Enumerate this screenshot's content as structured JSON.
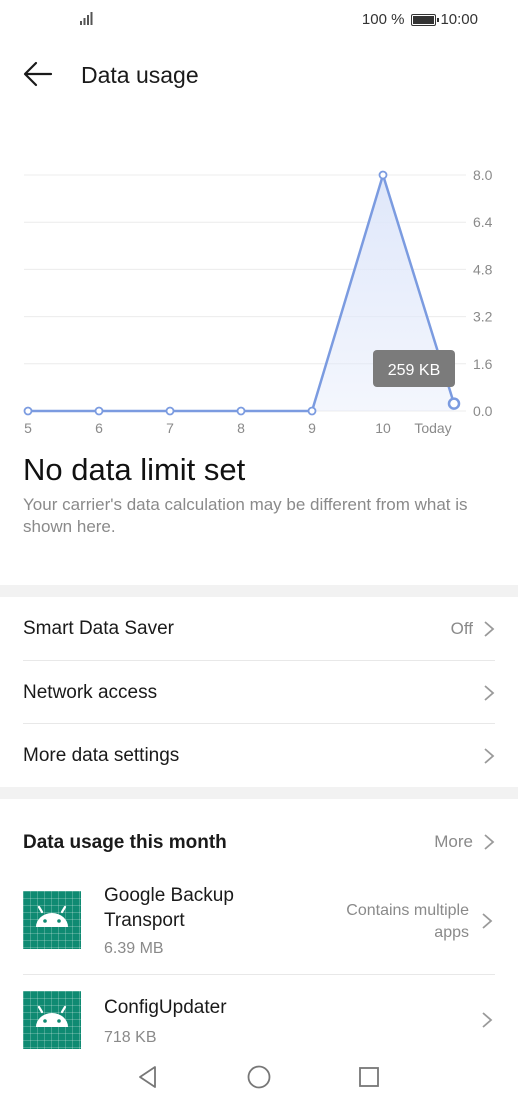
{
  "status_bar": {
    "battery": "100 %",
    "time": "10:00"
  },
  "header": {
    "title": "Data usage"
  },
  "chart_data": {
    "type": "area",
    "categories": [
      "5",
      "6",
      "7",
      "8",
      "9",
      "10",
      "Today"
    ],
    "values": [
      0,
      0,
      0,
      0,
      0,
      8.0,
      0.25
    ],
    "y_ticks": [
      "8.0",
      "6.4",
      "4.8",
      "3.2",
      "1.6",
      "0.0"
    ],
    "ylim": [
      0,
      8.0
    ],
    "tooltip": "259 KB",
    "line_color": "#7b9be0",
    "fill_color": "#dfe7fa",
    "grid": true
  },
  "limit": {
    "title": "No data limit set",
    "description": "Your carrier's data calculation may be different from what is shown here."
  },
  "settings": {
    "smart_data_saver": {
      "label": "Smart Data Saver",
      "value": "Off"
    },
    "network_access": {
      "label": "Network access"
    },
    "more_data_settings": {
      "label": "More data settings"
    }
  },
  "usage_section": {
    "title": "Data usage this month",
    "more_label": "More",
    "apps": [
      {
        "name": "Google Backup Transport",
        "size": "6.39 MB",
        "note": "Contains multiple apps",
        "icon": "android-icon"
      },
      {
        "name": "ConfigUpdater",
        "size": "718 KB",
        "icon": "android-icon"
      }
    ]
  },
  "colors": {
    "accent": "#7b9be0",
    "app_icon_bg": "#0f8a72",
    "muted_text": "#8a8a8a"
  }
}
